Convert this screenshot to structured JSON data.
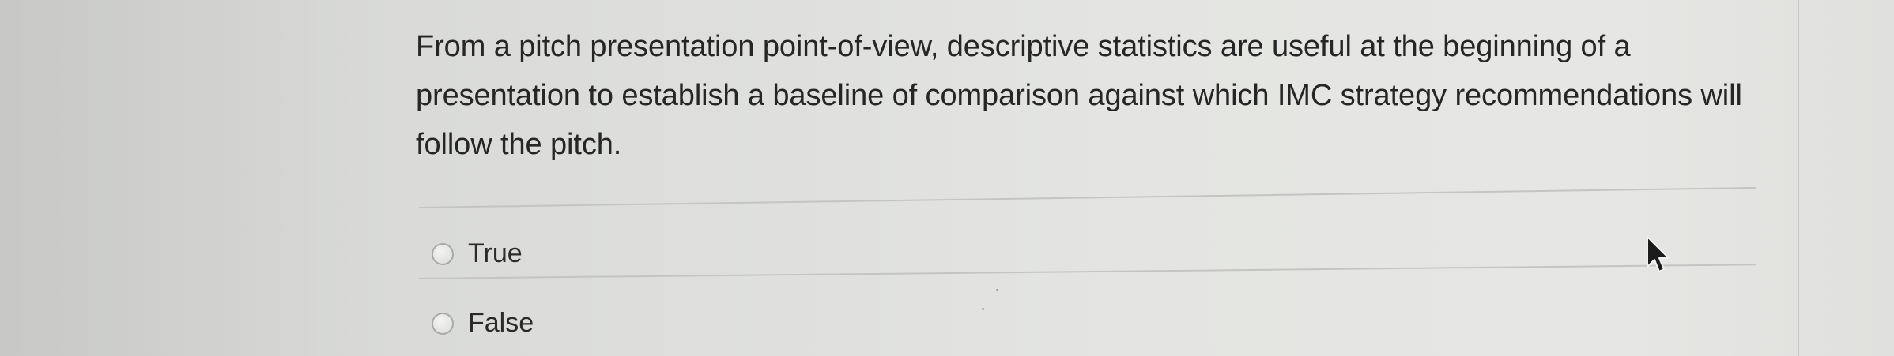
{
  "question": {
    "text": "From a pitch presentation point-of-view, descriptive statistics are useful at the beginning of a presentation to establish a baseline of comparison against which IMC strategy recommendations will follow the pitch."
  },
  "options": [
    {
      "label": "True",
      "selected": false
    },
    {
      "label": "False",
      "selected": false
    }
  ],
  "cursor": {
    "icon": "mouse-pointer-icon"
  }
}
